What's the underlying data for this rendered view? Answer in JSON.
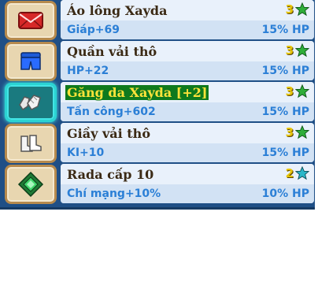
{
  "items": [
    {
      "name": "Áo lông Xayda",
      "stat": "Giáp+69",
      "hp": "15% HP",
      "stars": "3",
      "star_color": "#2fae3a",
      "highlight": false,
      "icon": "red-envelope-icon"
    },
    {
      "name": "Quần vải thô",
      "stat": "HP+22",
      "hp": "15% HP",
      "stars": "3",
      "star_color": "#2fae3a",
      "highlight": false,
      "icon": "blue-pants-icon"
    },
    {
      "name": "Găng da Xayda [+2]",
      "stat": "Tấn công+602",
      "hp": "15% HP",
      "stars": "3",
      "star_color": "#2fae3a",
      "highlight": true,
      "icon": "gloves-icon"
    },
    {
      "name": "Giầy vải thô",
      "stat": "KI+10",
      "hp": "15% HP",
      "stars": "3",
      "star_color": "#2fae3a",
      "highlight": false,
      "icon": "boots-icon"
    },
    {
      "name": "Rada cấp 10",
      "stat": "Chí mạng+10%",
      "hp": "10% HP",
      "stars": "2",
      "star_color": "#2bb7c9",
      "highlight": false,
      "icon": "radar-icon"
    }
  ]
}
